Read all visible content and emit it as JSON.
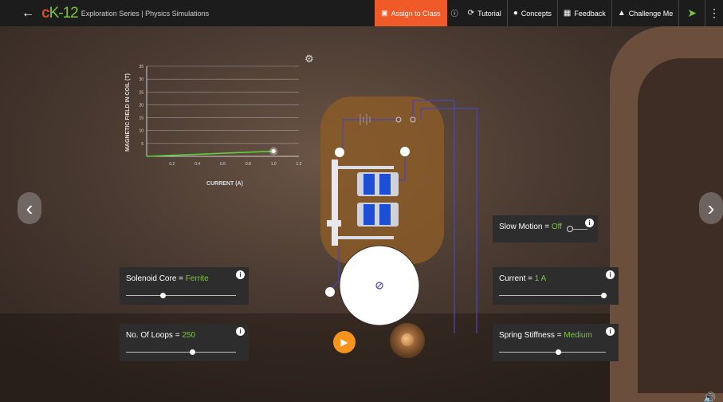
{
  "header": {
    "back_icon": "back-arrow-icon",
    "logo_c": "c",
    "logo_k12": "K-12",
    "subtitle": "Exploration Series | Physics Simulations",
    "assign_label": "Assign to Class",
    "tutorial_label": "Tutorial",
    "concepts_label": "Concepts",
    "feedback_label": "Feedback",
    "challenge_label": "Challenge Me",
    "colors": {
      "accent": "#f05a28",
      "brand_green": "#7dc242",
      "bar": "#1c1c1c"
    }
  },
  "chart_data": {
    "type": "line",
    "title": "",
    "xlabel": "CURRENT (A)",
    "ylabel": "MAGNETIC FIELD IN COIL (T)",
    "xlim": [
      0,
      1.2
    ],
    "ylim": [
      0,
      35
    ],
    "x_ticks": [
      "0.2",
      "0.4",
      "0.6",
      "0.8",
      "1.0",
      "1.2"
    ],
    "y_ticks": [
      "5",
      "10",
      "15",
      "20",
      "25",
      "30",
      "35"
    ],
    "series": [
      {
        "x": [
          0,
          1.0
        ],
        "y": [
          0,
          2
        ],
        "color": "#5bd13b"
      }
    ],
    "grid": true
  },
  "controls": {
    "solenoid_core": {
      "label": "Solenoid Core = ",
      "value": "Ferrite",
      "slider": 0.33
    },
    "loops": {
      "label": "No. Of Loops = ",
      "value": "250",
      "slider": 0.6
    },
    "slow_motion": {
      "label": "Slow Motion = ",
      "value": "Off"
    },
    "current": {
      "label": "Current = ",
      "value": "1 A",
      "slider": 0.98
    },
    "spring": {
      "label": "Spring Stiffness = ",
      "value": "Medium",
      "slider": 0.55
    },
    "info_glyph": "i"
  }
}
